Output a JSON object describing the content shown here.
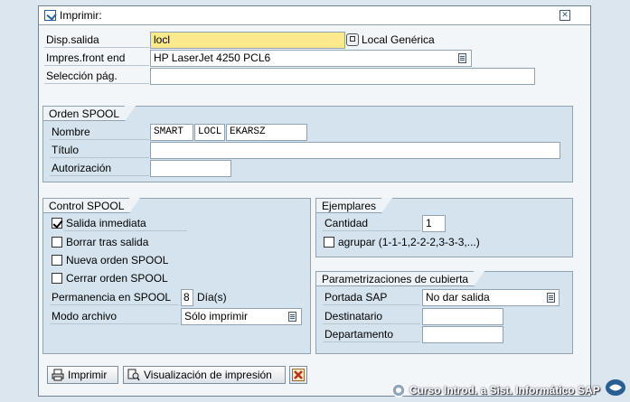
{
  "dialog": {
    "title": "Imprimir:"
  },
  "fields": {
    "output_device_label": "Disp.salida",
    "output_device_value": "locl",
    "output_device_desc": "Local Genérica",
    "frontend_printer_label": "Impres.front end",
    "frontend_printer_value": "HP LaserJet 4250 PCL6",
    "page_selection_label": "Selección pág.",
    "page_selection_value": ""
  },
  "spool_request": {
    "title": "Orden SPOOL",
    "name_label": "Nombre",
    "name_parts": [
      "SMART",
      "LOCL",
      "EKARSZ"
    ],
    "title_label": "Título",
    "title_value": "",
    "authorization_label": "Autorización",
    "authorization_value": ""
  },
  "spool_control": {
    "title": "Control SPOOL",
    "print_immediately": "Salida inmediata",
    "print_immediately_checked": true,
    "delete_after": "Borrar tras salida",
    "delete_after_checked": false,
    "new_request": "Nueva orden SPOOL",
    "new_request_checked": false,
    "close_request": "Cerrar orden SPOOL",
    "close_request_checked": false,
    "retention_label": "Permanencia en SPOOL",
    "retention_value": "8",
    "retention_unit": "Día(s)",
    "archive_mode_label": "Modo archivo",
    "archive_mode_value": "Sólo imprimir"
  },
  "copies": {
    "title": "Ejemplares",
    "quantity_label": "Cantidad",
    "quantity_value": "1",
    "collate_label": "agrupar (1-1-1,2-2-2,3-3-3,...)",
    "collate_checked": false
  },
  "cover_page": {
    "title": "Parametrizaciones de cubierta",
    "sap_cover_label": "Portada SAP",
    "sap_cover_value": "No dar salida",
    "recipient_label": "Destinatario",
    "recipient_value": "",
    "department_label": "Departamento",
    "department_value": ""
  },
  "buttons": {
    "print": "Imprimir",
    "print_preview": "Visualización de impresión"
  },
  "footer": {
    "brand": "Curso Introd. a Sist. Informático SAP"
  }
}
